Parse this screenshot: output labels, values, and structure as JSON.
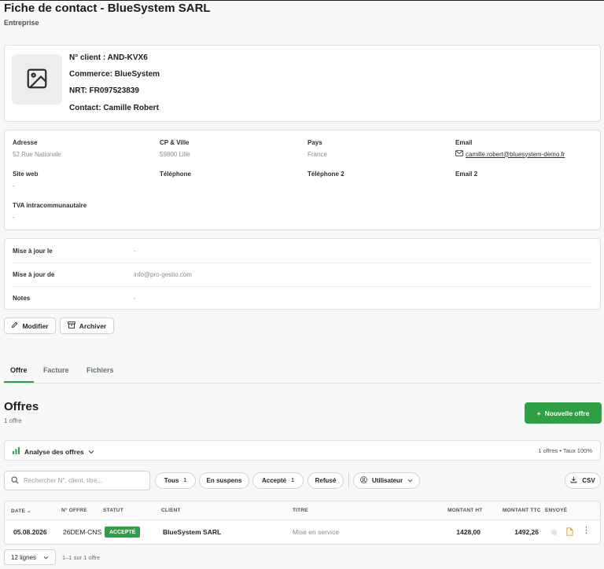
{
  "header": {
    "title": "Fiche de contact - BlueSystem SARL",
    "subtitle": "Entreprise"
  },
  "summary": {
    "client_no": "N° client : AND-KVX6",
    "commerce": "Commerce: BlueSystem",
    "nrt": "NRT: FR097523839",
    "contact": "Contact: Camille Robert",
    "avatar_icon": "image-placeholder-icon"
  },
  "address": {
    "adresse_label": "Adresse",
    "adresse_value": "52 Rue Nationale",
    "cp_label": "CP & Ville",
    "cp_value": "59800 Lille",
    "pays_label": "Pays",
    "pays_value": "France",
    "email_label": "Email",
    "email_value": "camille.robert@bluesystem-demo.fr",
    "site_label": "Site web",
    "site_value": "-",
    "tel_label": "Téléphone",
    "tel2_label": "Téléphone 2",
    "email2_label": "Email 2",
    "tva_label": "TVA intracommunautaire",
    "tva_value": "-"
  },
  "meta": {
    "rows": [
      {
        "label": "Mise à jour le",
        "value": "-"
      },
      {
        "label": "Mise à jour de",
        "value": "info@pro-gestio.com"
      },
      {
        "label": "Notes",
        "value": "-"
      }
    ]
  },
  "actions": {
    "edit_label": "Modifier",
    "archive_label": "Archiver"
  },
  "tabs": [
    "Offre",
    "Facture",
    "Fichiers"
  ],
  "offers": {
    "title": "Offres",
    "count": "1 offre",
    "new_button": "Nouvelle offre",
    "analysis_label": "Analyse des offres",
    "analysis_stats": "1 offres • Taux 100%",
    "search_placeholder": "Rechercher N°, client, titre...",
    "filters": [
      {
        "label": "Tous",
        "count": "1"
      },
      {
        "label": "En suspens",
        "count": ""
      },
      {
        "label": "Accepté",
        "count": "1"
      },
      {
        "label": "Refusé",
        "count": ""
      }
    ],
    "user_filter": "Utilisateur",
    "csv_label": "CSV",
    "columns": [
      "DATE",
      "N° OFFRE",
      "STATUT",
      "CLIENT",
      "TITRE",
      "MONTANT HT",
      "MONTANT TTC",
      "ENVOYÉ"
    ],
    "rows": [
      {
        "date": "05.08.2026",
        "number": "26DEM-CNS",
        "status": "ACCEPTÉ",
        "client": "BlueSystem SARL",
        "title": "Mise en service",
        "ht": "1428,00",
        "ttc": "1492,26"
      }
    ],
    "page_size": "12 lignes",
    "pager_info": "1–1 sur 1 offre"
  },
  "colors": {
    "accent": "#2ea043",
    "border": "#dcdfe2",
    "muted_text": "#868c92"
  }
}
